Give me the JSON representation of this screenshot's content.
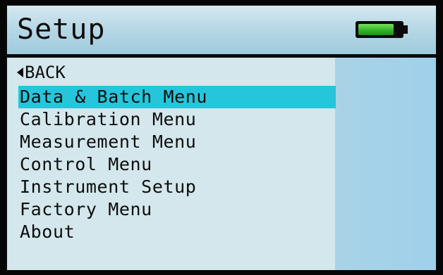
{
  "header": {
    "title": "Setup",
    "battery": {
      "icon": "battery-icon",
      "charge_level": 0.85,
      "fill_color": "#2fb12a"
    }
  },
  "menu": {
    "back_label": "BACK",
    "back_icon": "left-arrow-icon",
    "items": [
      {
        "label": "Data & Batch Menu",
        "selected": true
      },
      {
        "label": "Calibration Menu",
        "selected": false
      },
      {
        "label": "Measurement Menu",
        "selected": false
      },
      {
        "label": "Control Menu",
        "selected": false
      },
      {
        "label": "Instrument Setup",
        "selected": false
      },
      {
        "label": "Factory Menu",
        "selected": false
      },
      {
        "label": "About",
        "selected": false
      }
    ],
    "highlight_color": "#25c6dc"
  }
}
